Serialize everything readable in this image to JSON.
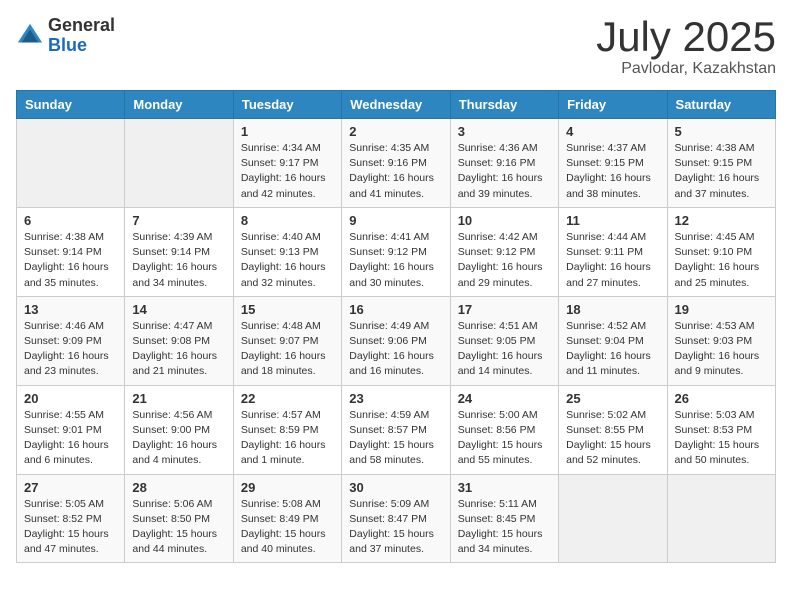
{
  "logo": {
    "general": "General",
    "blue": "Blue"
  },
  "title": "July 2025",
  "subtitle": "Pavlodar, Kazakhstan",
  "weekdays": [
    "Sunday",
    "Monday",
    "Tuesday",
    "Wednesday",
    "Thursday",
    "Friday",
    "Saturday"
  ],
  "weeks": [
    [
      {
        "day": "",
        "info": ""
      },
      {
        "day": "",
        "info": ""
      },
      {
        "day": "1",
        "info": "Sunrise: 4:34 AM\nSunset: 9:17 PM\nDaylight: 16 hours\nand 42 minutes."
      },
      {
        "day": "2",
        "info": "Sunrise: 4:35 AM\nSunset: 9:16 PM\nDaylight: 16 hours\nand 41 minutes."
      },
      {
        "day": "3",
        "info": "Sunrise: 4:36 AM\nSunset: 9:16 PM\nDaylight: 16 hours\nand 39 minutes."
      },
      {
        "day": "4",
        "info": "Sunrise: 4:37 AM\nSunset: 9:15 PM\nDaylight: 16 hours\nand 38 minutes."
      },
      {
        "day": "5",
        "info": "Sunrise: 4:38 AM\nSunset: 9:15 PM\nDaylight: 16 hours\nand 37 minutes."
      }
    ],
    [
      {
        "day": "6",
        "info": "Sunrise: 4:38 AM\nSunset: 9:14 PM\nDaylight: 16 hours\nand 35 minutes."
      },
      {
        "day": "7",
        "info": "Sunrise: 4:39 AM\nSunset: 9:14 PM\nDaylight: 16 hours\nand 34 minutes."
      },
      {
        "day": "8",
        "info": "Sunrise: 4:40 AM\nSunset: 9:13 PM\nDaylight: 16 hours\nand 32 minutes."
      },
      {
        "day": "9",
        "info": "Sunrise: 4:41 AM\nSunset: 9:12 PM\nDaylight: 16 hours\nand 30 minutes."
      },
      {
        "day": "10",
        "info": "Sunrise: 4:42 AM\nSunset: 9:12 PM\nDaylight: 16 hours\nand 29 minutes."
      },
      {
        "day": "11",
        "info": "Sunrise: 4:44 AM\nSunset: 9:11 PM\nDaylight: 16 hours\nand 27 minutes."
      },
      {
        "day": "12",
        "info": "Sunrise: 4:45 AM\nSunset: 9:10 PM\nDaylight: 16 hours\nand 25 minutes."
      }
    ],
    [
      {
        "day": "13",
        "info": "Sunrise: 4:46 AM\nSunset: 9:09 PM\nDaylight: 16 hours\nand 23 minutes."
      },
      {
        "day": "14",
        "info": "Sunrise: 4:47 AM\nSunset: 9:08 PM\nDaylight: 16 hours\nand 21 minutes."
      },
      {
        "day": "15",
        "info": "Sunrise: 4:48 AM\nSunset: 9:07 PM\nDaylight: 16 hours\nand 18 minutes."
      },
      {
        "day": "16",
        "info": "Sunrise: 4:49 AM\nSunset: 9:06 PM\nDaylight: 16 hours\nand 16 minutes."
      },
      {
        "day": "17",
        "info": "Sunrise: 4:51 AM\nSunset: 9:05 PM\nDaylight: 16 hours\nand 14 minutes."
      },
      {
        "day": "18",
        "info": "Sunrise: 4:52 AM\nSunset: 9:04 PM\nDaylight: 16 hours\nand 11 minutes."
      },
      {
        "day": "19",
        "info": "Sunrise: 4:53 AM\nSunset: 9:03 PM\nDaylight: 16 hours\nand 9 minutes."
      }
    ],
    [
      {
        "day": "20",
        "info": "Sunrise: 4:55 AM\nSunset: 9:01 PM\nDaylight: 16 hours\nand 6 minutes."
      },
      {
        "day": "21",
        "info": "Sunrise: 4:56 AM\nSunset: 9:00 PM\nDaylight: 16 hours\nand 4 minutes."
      },
      {
        "day": "22",
        "info": "Sunrise: 4:57 AM\nSunset: 8:59 PM\nDaylight: 16 hours\nand 1 minute."
      },
      {
        "day": "23",
        "info": "Sunrise: 4:59 AM\nSunset: 8:57 PM\nDaylight: 15 hours\nand 58 minutes."
      },
      {
        "day": "24",
        "info": "Sunrise: 5:00 AM\nSunset: 8:56 PM\nDaylight: 15 hours\nand 55 minutes."
      },
      {
        "day": "25",
        "info": "Sunrise: 5:02 AM\nSunset: 8:55 PM\nDaylight: 15 hours\nand 52 minutes."
      },
      {
        "day": "26",
        "info": "Sunrise: 5:03 AM\nSunset: 8:53 PM\nDaylight: 15 hours\nand 50 minutes."
      }
    ],
    [
      {
        "day": "27",
        "info": "Sunrise: 5:05 AM\nSunset: 8:52 PM\nDaylight: 15 hours\nand 47 minutes."
      },
      {
        "day": "28",
        "info": "Sunrise: 5:06 AM\nSunset: 8:50 PM\nDaylight: 15 hours\nand 44 minutes."
      },
      {
        "day": "29",
        "info": "Sunrise: 5:08 AM\nSunset: 8:49 PM\nDaylight: 15 hours\nand 40 minutes."
      },
      {
        "day": "30",
        "info": "Sunrise: 5:09 AM\nSunset: 8:47 PM\nDaylight: 15 hours\nand 37 minutes."
      },
      {
        "day": "31",
        "info": "Sunrise: 5:11 AM\nSunset: 8:45 PM\nDaylight: 15 hours\nand 34 minutes."
      },
      {
        "day": "",
        "info": ""
      },
      {
        "day": "",
        "info": ""
      }
    ]
  ]
}
